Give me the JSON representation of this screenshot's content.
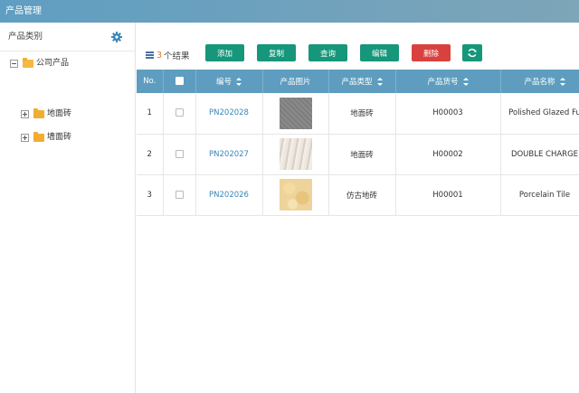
{
  "window": {
    "title": "产品管理"
  },
  "sidebar": {
    "title": "产品类别",
    "tree": [
      {
        "label": "公司产品",
        "expanded": true
      },
      {
        "label": "地面砖",
        "expanded": false
      },
      {
        "label": "墙面砖",
        "expanded": false
      }
    ]
  },
  "toolbar": {
    "result_count": "3",
    "result_suffix": "个结果",
    "add_label": "添加",
    "copy_label": "复制",
    "query_label": "查询",
    "edit_label": "编辑",
    "delete_label": "删除"
  },
  "table": {
    "headers": [
      "No.",
      "",
      "编号",
      "产品图片",
      "产品类型",
      "产品货号",
      "产品名称"
    ],
    "rows": [
      {
        "no": "1",
        "code": "PN202028",
        "image": "gray-tile",
        "type": "地面砖",
        "sku": "H00003",
        "name": "Polished Glazed Fu"
      },
      {
        "no": "2",
        "code": "PN202027",
        "image": "beige-wood-tile",
        "type": "地面砖",
        "sku": "H00002",
        "name": "DOUBLE CHARGE"
      },
      {
        "no": "3",
        "code": "PN202026",
        "image": "yellow-marble-tile",
        "type": "仿古地砖",
        "sku": "H00001",
        "name": "Porcelain Tile"
      }
    ]
  },
  "colors": {
    "header_bar": "#5e9dbf",
    "primary_button": "#16967a",
    "danger_button": "#d9413e",
    "link": "#3a86b8",
    "count": "#e07a1f"
  }
}
